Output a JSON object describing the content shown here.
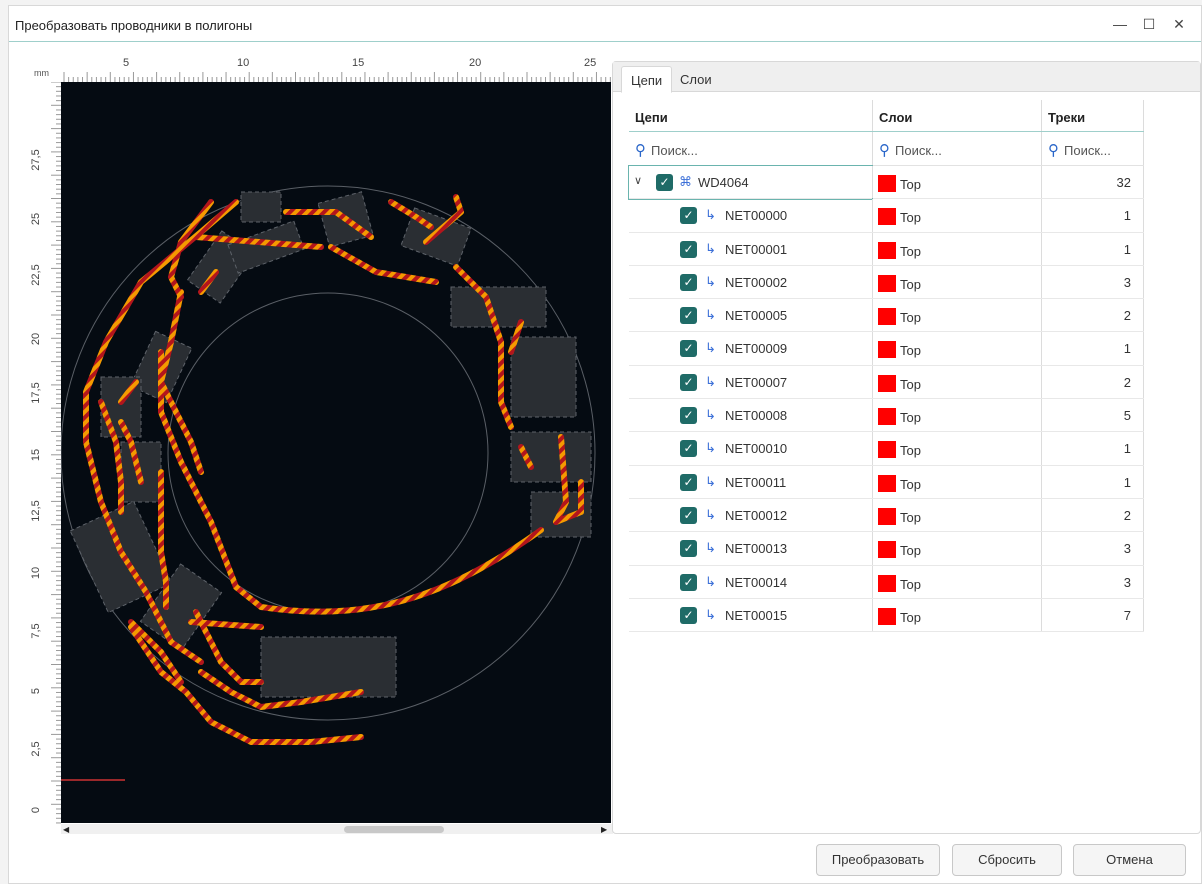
{
  "window": {
    "title": "Преобразовать проводники в полигоны",
    "controls": {
      "minimize": "—",
      "maximize": "☐",
      "close": "✕"
    }
  },
  "canvas": {
    "unit_label": "mm",
    "x_ticks": [
      "5",
      "10",
      "15",
      "20",
      "25"
    ],
    "y_ticks": [
      "27,5",
      "25",
      "22,5",
      "20",
      "17,5",
      "15",
      "12,5",
      "10",
      "7,5",
      "5",
      "2,5",
      "0"
    ]
  },
  "tabs": [
    {
      "label": "Цепи",
      "active": true
    },
    {
      "label": "Слои",
      "active": false
    }
  ],
  "table": {
    "headers": {
      "nets": "Цепи",
      "layers": "Слои",
      "tracks": "Треки"
    },
    "search_placeholder": "Поиск...",
    "group": {
      "name": "WD4064",
      "layer": "Top",
      "tracks": "32",
      "checked": true,
      "expanded": true
    },
    "rows": [
      {
        "name": "NET00000",
        "layer": "Top",
        "tracks": "1"
      },
      {
        "name": "NET00001",
        "layer": "Top",
        "tracks": "1"
      },
      {
        "name": "NET00002",
        "layer": "Top",
        "tracks": "3"
      },
      {
        "name": "NET00005",
        "layer": "Top",
        "tracks": "2"
      },
      {
        "name": "NET00009",
        "layer": "Top",
        "tracks": "1"
      },
      {
        "name": "NET00007",
        "layer": "Top",
        "tracks": "2"
      },
      {
        "name": "NET00008",
        "layer": "Top",
        "tracks": "5"
      },
      {
        "name": "NET00010",
        "layer": "Top",
        "tracks": "1"
      },
      {
        "name": "NET00011",
        "layer": "Top",
        "tracks": "1"
      },
      {
        "name": "NET00012",
        "layer": "Top",
        "tracks": "2"
      },
      {
        "name": "NET00013",
        "layer": "Top",
        "tracks": "3"
      },
      {
        "name": "NET00014",
        "layer": "Top",
        "tracks": "3"
      },
      {
        "name": "NET00015",
        "layer": "Top",
        "tracks": "7"
      }
    ],
    "layer_color": "#ff0000"
  },
  "buttons": {
    "convert": "Преобразовать",
    "reset": "Сбросить",
    "cancel": "Отмена"
  },
  "colors": {
    "accent": "#1f6b67",
    "board_bg": "#050b12",
    "track_orange": "#f59a00",
    "track_red": "#b3151c"
  }
}
